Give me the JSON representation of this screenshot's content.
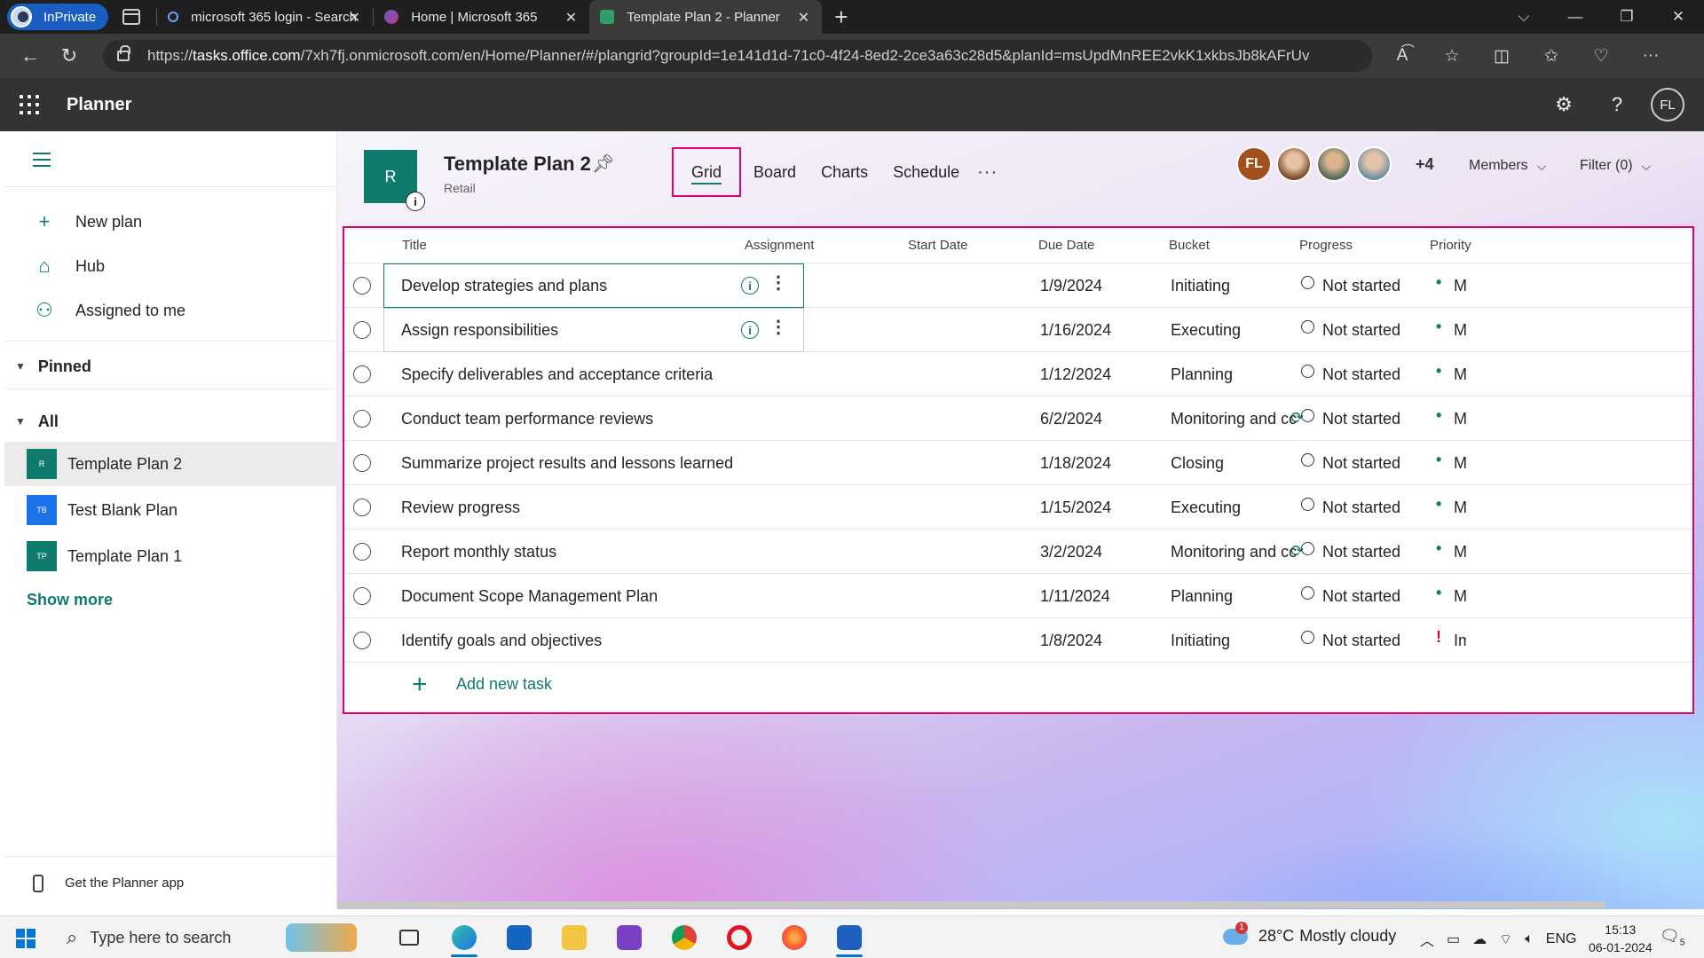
{
  "browser": {
    "inprivate_label": "InPrivate",
    "tabs": [
      {
        "title": "microsoft 365 login - Search",
        "close": "✕"
      },
      {
        "title": "Home | Microsoft 365",
        "close": "✕"
      },
      {
        "title": "Template Plan 2 - Planner",
        "close": "✕"
      }
    ],
    "new_tab": "+",
    "url_prefix": "https://",
    "url_domain": "tasks.office.com",
    "url_rest": "/7xh7fj.onmicrosoft.com/en/Home/Planner/#/plangrid?groupId=1e141d1d-71c0-4f24-8ed2-2ce3a63c28d5&planId=msUpdMnREE2vkK1xkbsJb8kAFrUv"
  },
  "suite": {
    "app_name": "Planner",
    "user_initials": "FL"
  },
  "sidebar": {
    "nav": [
      {
        "label": "New plan",
        "icon": "plus-icon"
      },
      {
        "label": "Hub",
        "icon": "home-icon"
      },
      {
        "label": "Assigned to me",
        "icon": "person-icon"
      }
    ],
    "pinned_label": "Pinned",
    "all_label": "All",
    "plans": [
      {
        "label": "Template Plan 2",
        "badge": "R",
        "color": "#0f7b6c"
      },
      {
        "label": "Test Blank Plan",
        "badge": "TB",
        "color": "#1a73e8"
      },
      {
        "label": "Template Plan 1",
        "badge": "TP",
        "color": "#0f7b6c"
      }
    ],
    "show_more": "Show more",
    "get_app": "Get the Planner app"
  },
  "plan": {
    "icon_letter": "R",
    "info_glyph": "i",
    "title": "Template Plan 2",
    "subtitle": "Retail",
    "views": [
      "Grid",
      "Board",
      "Charts",
      "Schedule"
    ],
    "more": "···",
    "members_avatar_initials": "FL",
    "extra_members": "+4",
    "members_label": "Members",
    "filter_label": "Filter (0)"
  },
  "grid": {
    "columns": [
      "Title",
      "Assignment",
      "Start Date",
      "Due Date",
      "Bucket",
      "Progress",
      "Priority"
    ],
    "rows": [
      {
        "title": "Develop strategies and plans",
        "due": "1/9/2024",
        "bucket": "Initiating",
        "progress": "Not started",
        "priority": "•",
        "priority_text": "Medium",
        "recurring": false
      },
      {
        "title": "Assign responsibilities",
        "due": "1/16/2024",
        "bucket": "Executing",
        "progress": "Not started",
        "priority": "•",
        "priority_text": "Medium",
        "recurring": false
      },
      {
        "title": "Specify deliverables and acceptance criteria",
        "due": "1/12/2024",
        "bucket": "Planning",
        "progress": "Not started",
        "priority": "•",
        "priority_text": "Medium",
        "recurring": false
      },
      {
        "title": "Conduct team performance reviews",
        "due": "6/2/2024",
        "bucket": "Monitoring and cc",
        "progress": "Not started",
        "priority": "•",
        "priority_text": "Medium",
        "recurring": true
      },
      {
        "title": "Summarize project results and lessons learned",
        "due": "1/18/2024",
        "bucket": "Closing",
        "progress": "Not started",
        "priority": "•",
        "priority_text": "Medium",
        "recurring": false
      },
      {
        "title": "Review progress",
        "due": "1/15/2024",
        "bucket": "Executing",
        "progress": "Not started",
        "priority": "•",
        "priority_text": "Medium",
        "recurring": false
      },
      {
        "title": "Report monthly status",
        "due": "3/2/2024",
        "bucket": "Monitoring and cc",
        "progress": "Not started",
        "priority": "•",
        "priority_text": "Medium",
        "recurring": true
      },
      {
        "title": "Document Scope Management Plan",
        "due": "1/11/2024",
        "bucket": "Planning",
        "progress": "Not started",
        "priority": "•",
        "priority_text": "Medium",
        "recurring": false
      },
      {
        "title": "Identify goals and objectives",
        "due": "1/8/2024",
        "bucket": "Initiating",
        "progress": "Not started",
        "priority": "!",
        "priority_text": "Important",
        "recurring": false
      }
    ],
    "add_task": "Add new task"
  },
  "taskbar": {
    "search_placeholder": "Type here to search",
    "weather_temp": "28°C",
    "weather_text": "Mostly cloudy",
    "lang": "ENG",
    "time": "15:13",
    "date": "06-01-2024",
    "notif_count": "5"
  },
  "colors": {
    "accent": "#0f7b6c",
    "highlight": "#e3006f",
    "suite": "#333333"
  }
}
